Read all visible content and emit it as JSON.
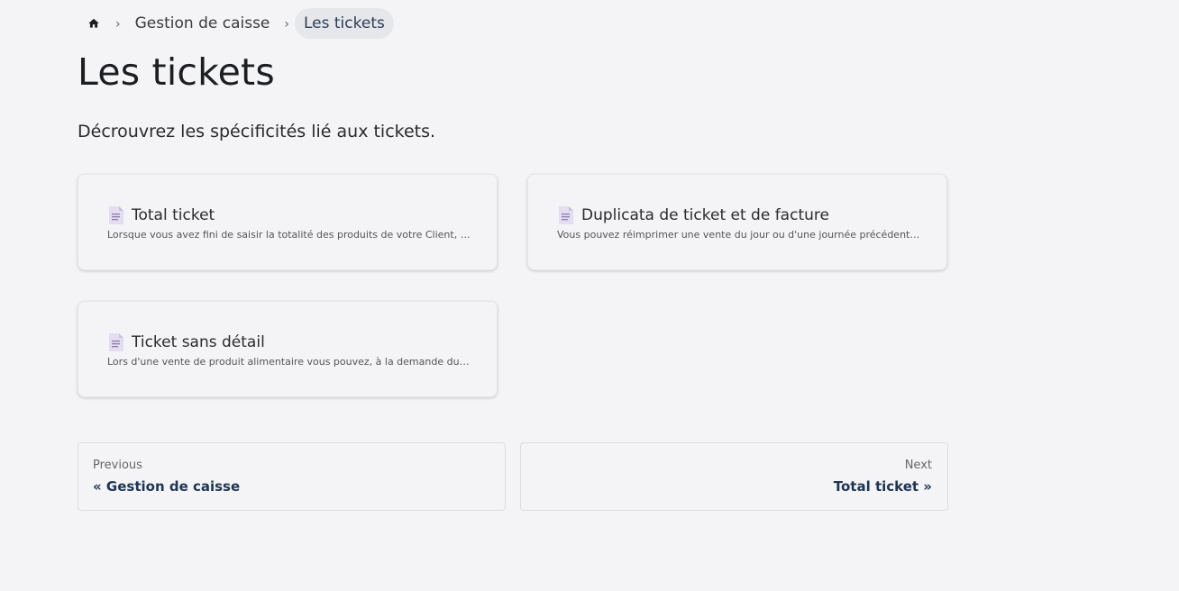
{
  "breadcrumb": {
    "home_icon": "home-icon",
    "separator": "›",
    "items": [
      {
        "label": "Gestion de caisse"
      },
      {
        "label": "Les tickets"
      }
    ]
  },
  "page": {
    "title": "Les tickets",
    "intro": "Décrouvrez les spécificités lié aux tickets."
  },
  "cards": [
    {
      "icon": "document-icon",
      "title": "Total ticket",
      "description": "Lorsque vous avez fini de saisir la totalité des produits de votre Client, a..."
    },
    {
      "icon": "document-icon",
      "title": "Duplicata de ticket et de facture",
      "description": "Vous pouvez réimprimer une vente du jour ou d'une journée précédente..."
    },
    {
      "icon": "document-icon",
      "title": "Ticket sans détail",
      "description": "Lors d'une vente de produit alimentaire vous pouvez, à la demande du cl..."
    }
  ],
  "pagination": {
    "previous": {
      "sub_label": "Previous",
      "label": "« Gestion de caisse"
    },
    "next": {
      "sub_label": "Next",
      "label": "Total ticket »"
    }
  },
  "colors": {
    "background": "#f4f4f6",
    "link": "#1e3553",
    "breadcrumb_active_bg": "#e6e7ea"
  }
}
